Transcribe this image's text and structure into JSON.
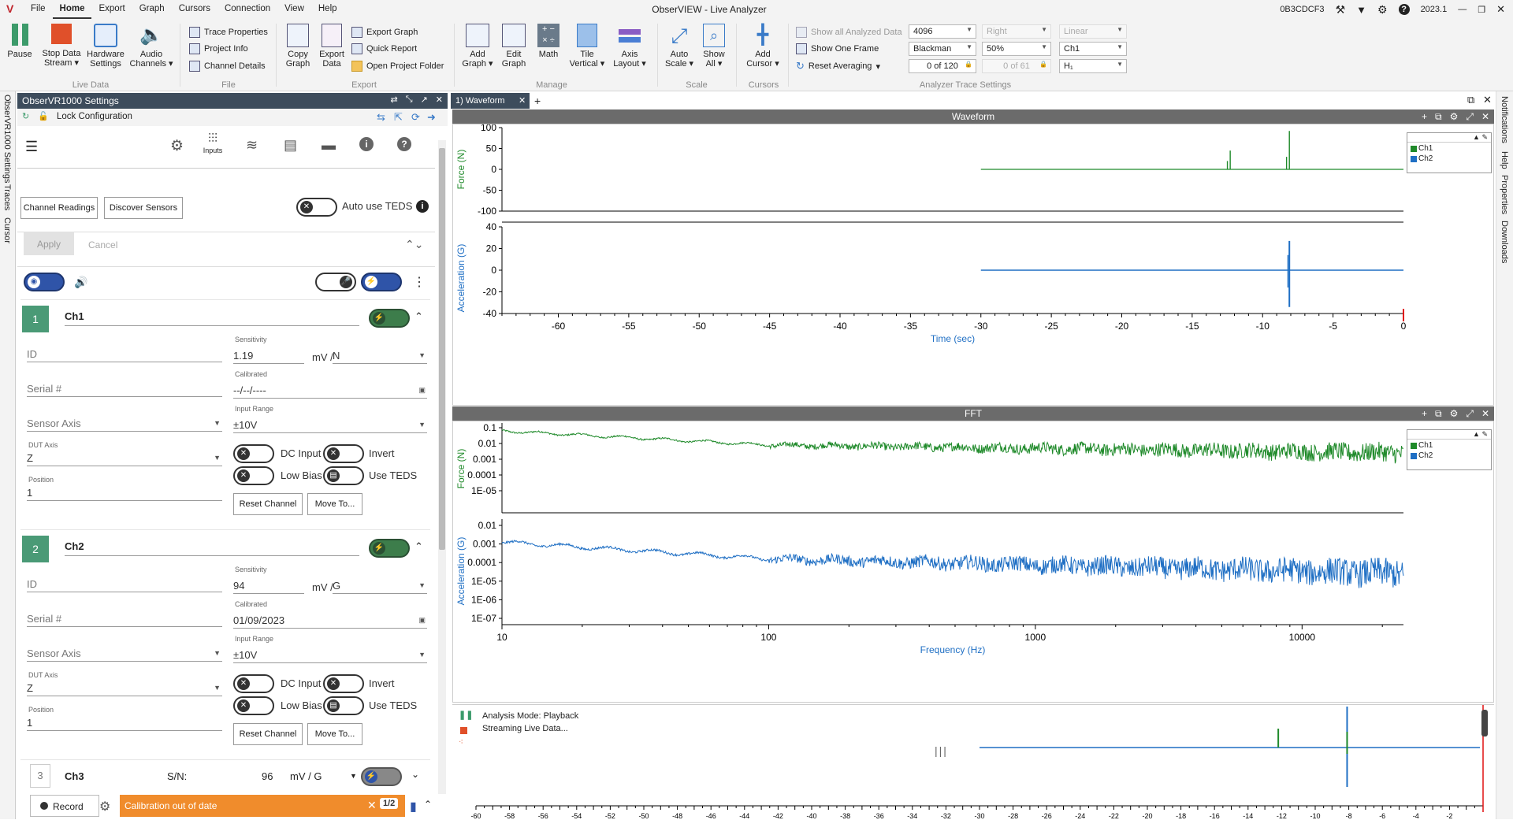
{
  "titlebar": {
    "app_title": "ObserVIEW - Live Analyzer",
    "menu": [
      "File",
      "Home",
      "Export",
      "Graph",
      "Cursors",
      "Connection",
      "View",
      "Help"
    ],
    "active_menu": "Home",
    "device_id": "0B3CDCF3",
    "version": "2023.1"
  },
  "ribbon": {
    "live_data": {
      "label": "Live Data",
      "pause": "Pause",
      "stop_data_stream": "Stop Data Stream",
      "hardware_settings": "Hardware Settings",
      "audio_channels": "Audio Channels"
    },
    "file": {
      "label": "File",
      "trace_properties": "Trace Properties",
      "project_info": "Project Info",
      "channel_details": "Channel Details"
    },
    "export": {
      "label": "Export",
      "copy_graph": "Copy Graph",
      "export_data": "Export Data",
      "export_graph": "Export Graph",
      "quick_report": "Quick Report",
      "open_project_folder": "Open Project Folder"
    },
    "manage": {
      "label": "Manage",
      "add_graph": "Add Graph",
      "edit_graph": "Edit Graph",
      "math": "Math",
      "tile_vertical": "Tile Vertical",
      "axis_layout": "Axis Layout"
    },
    "scale": {
      "label": "Scale",
      "auto_scale": "Auto Scale",
      "show_all": "Show All"
    },
    "cursors": {
      "label": "Cursors",
      "add_cursor": "Add Cursor"
    },
    "analyzer": {
      "label": "Analyzer Trace Settings",
      "show_all_analyzed": "Show all Analyzed Data",
      "show_one_frame": "Show One Frame",
      "reset_averaging": "Reset Averaging",
      "fft_size": "4096",
      "window": "Blackman",
      "overlap": "50%",
      "frame_counter": "0 of 120",
      "side": "Right",
      "avg_counter": "0 of 61",
      "scale_mode": "Linear",
      "channel": "Ch1",
      "function": "H₁"
    }
  },
  "rails": {
    "left": [
      "ObserVR1000 Settings",
      "Traces",
      "Cursor"
    ],
    "right": [
      "Notifications",
      "Help",
      "Properties",
      "Downloads"
    ]
  },
  "settings_panel": {
    "title": "ObserVR1000 Settings",
    "lock_config": "Lock Configuration",
    "inputs_tab": "Inputs",
    "channel_readings": "Channel Readings",
    "discover_sensors": "Discover Sensors",
    "auto_use_teds": "Auto use TEDS",
    "apply": "Apply",
    "cancel": "Cancel",
    "labels": {
      "sensitivity": "Sensitivity",
      "calibrated": "Calibrated",
      "input_range": "Input Range",
      "dut_axis": "DUT Axis",
      "position": "Position",
      "dc_input": "DC Input",
      "invert": "Invert",
      "low_bias": "Low Bias",
      "use_teds": "Use TEDS",
      "reset_channel": "Reset Channel",
      "move_to": "Move To...",
      "id": "ID",
      "serial": "Serial #",
      "sensor_axis": "Sensor Axis",
      "sn": "S/N:"
    },
    "channels": [
      {
        "number": "1",
        "name": "Ch1",
        "sensitivity": "1.19",
        "unit_prefix": "mV /",
        "unit": "N",
        "calibrated": "--/--/----",
        "input_range": "±10V",
        "dut_axis": "Z",
        "position": "1"
      },
      {
        "number": "2",
        "name": "Ch2",
        "sensitivity": "94",
        "unit_prefix": "mV /",
        "unit": "G",
        "calibrated": "01/09/2023",
        "input_range": "±10V",
        "dut_axis": "Z",
        "position": "1"
      },
      {
        "number": "3",
        "name": "Ch3",
        "sensitivity_text": "96",
        "unit_text": "mV / G"
      }
    ],
    "record": "Record",
    "alert": "Calibration out of date",
    "alert_count": "1/2"
  },
  "graph_tab": "1) Waveform",
  "waveform": {
    "title": "Waveform",
    "legend": [
      "Ch1",
      "Ch2"
    ],
    "colors": {
      "ch1": "#1f8a2a",
      "ch2": "#1f6fc4"
    },
    "force": {
      "ylabel": "Force (N)",
      "yticks": [
        "100",
        "50",
        "0",
        "-50",
        "-100"
      ]
    },
    "accel": {
      "ylabel": "Acceleration (G)",
      "yticks": [
        "40",
        "20",
        "0",
        "-20",
        "-40"
      ]
    },
    "xlabel": "Time (sec)",
    "xticks": [
      "-60",
      "-55",
      "-50",
      "-45",
      "-40",
      "-35",
      "-30",
      "-25",
      "-20",
      "-15",
      "-10",
      "-5",
      "0"
    ]
  },
  "fft": {
    "title": "FFT",
    "legend": [
      "Ch1",
      "Ch2"
    ],
    "force": {
      "ylabel": "Force (N)",
      "yticks": [
        "0.1",
        "0.01",
        "0.001",
        "0.0001",
        "1E-05"
      ]
    },
    "accel": {
      "ylabel": "Acceleration (G)",
      "yticks": [
        "0.01",
        "0.001",
        "0.0001",
        "1E-05",
        "1E-06",
        "1E-07"
      ]
    },
    "xlabel": "Frequency (Hz)",
    "xticks": [
      "10",
      "100",
      "1000",
      "10000"
    ]
  },
  "overview": {
    "analysis_mode": "Analysis Mode: Playback",
    "streaming": "Streaming Live Data...",
    "xticks": [
      "-60",
      "-58",
      "-56",
      "-54",
      "-52",
      "-50",
      "-48",
      "-46",
      "-44",
      "-42",
      "-40",
      "-38",
      "-36",
      "-34",
      "-32",
      "-30",
      "-28",
      "-26",
      "-24",
      "-22",
      "-20",
      "-18",
      "-16",
      "-14",
      "-12",
      "-10",
      "-8",
      "-6",
      "-4",
      "-2"
    ]
  }
}
